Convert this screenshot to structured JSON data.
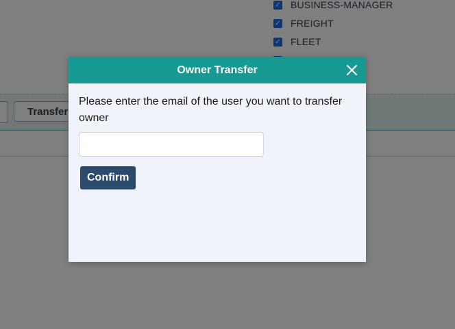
{
  "background": {
    "role_checkboxes": [
      {
        "label": "BUSINESS-MANAGER",
        "checked": true
      },
      {
        "label": "FREIGHT",
        "checked": true
      },
      {
        "label": "FLEET",
        "checked": true
      },
      {
        "label": "",
        "checked": true
      }
    ],
    "toolbar": {
      "transfer_button_label": "Transfer Owner"
    }
  },
  "modal": {
    "title": "Owner Transfer",
    "close_icon": "close-icon",
    "prompt": "Please enter the email of the user you want to transfer owner",
    "email_input": {
      "value": "",
      "placeholder": ""
    },
    "confirm_label": "Confirm"
  },
  "colors": {
    "header": "#179a93",
    "confirm_button": "#2c4a6b",
    "checkbox": "#1a6fe6",
    "modal_background": "#f0f3f9"
  }
}
